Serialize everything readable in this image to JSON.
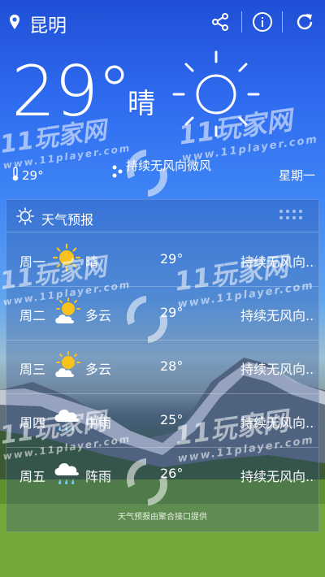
{
  "header": {
    "city": "昆明",
    "icons": [
      "location-pin-icon",
      "share-icon",
      "info-icon",
      "refresh-icon"
    ]
  },
  "current": {
    "temperature": "29°",
    "condition": "晴",
    "condition_icon": "sun-icon",
    "small_temp": "29°",
    "wind": "持续无风向微风",
    "weekday": "星期一"
  },
  "forecast": {
    "title": "天气预报",
    "days": [
      {
        "day": "周一",
        "icon": "sunny-icon",
        "condition": "晴",
        "temp": "29°",
        "wind": "持续无风向..."
      },
      {
        "day": "周二",
        "icon": "partly-cloudy-icon",
        "condition": "多云",
        "temp": "29°",
        "wind": "持续无风向..."
      },
      {
        "day": "周三",
        "icon": "partly-cloudy-icon",
        "condition": "多云",
        "temp": "28°",
        "wind": "持续无风向..."
      },
      {
        "day": "周四",
        "icon": "rain-cloud-icon",
        "condition": "中雨",
        "temp": "25°",
        "wind": "持续无风向..."
      },
      {
        "day": "周五",
        "icon": "rain-cloud-icon",
        "condition": "阵雨",
        "temp": "26°",
        "wind": "持续无风向..."
      }
    ],
    "footer": "天气预报由聚合接口提供"
  },
  "watermark": {
    "brand": "11玩家网",
    "url": "www.11player.com"
  },
  "colors": {
    "sky_top": "#1f4fd6",
    "sky_mid": "#3f86f5",
    "grass": "#7db13a",
    "sun_yellow": "#f7c21b"
  }
}
